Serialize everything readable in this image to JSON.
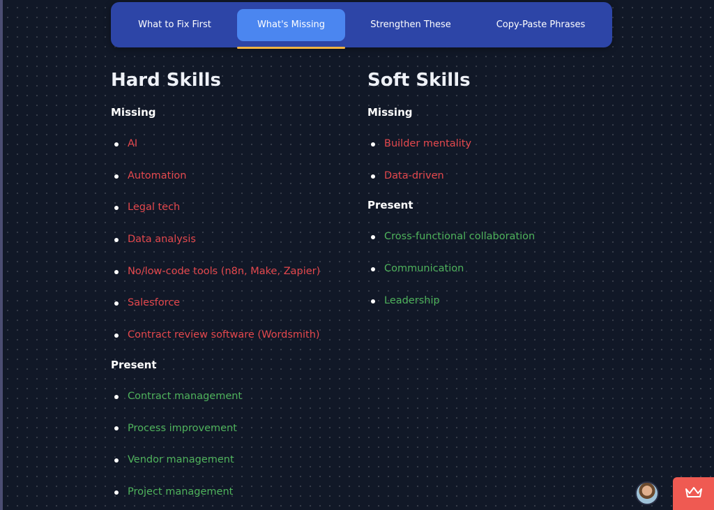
{
  "tabs": [
    {
      "label": "What to Fix First",
      "active": false
    },
    {
      "label": "What's Missing",
      "active": true
    },
    {
      "label": "Strengthen These",
      "active": false
    },
    {
      "label": "Copy-Paste Phrases",
      "active": false
    }
  ],
  "hard_skills": {
    "title": "Hard Skills",
    "missing_label": "Missing",
    "missing": [
      "AI",
      "Automation",
      "Legal tech",
      "Data analysis",
      "No/low-code tools (n8n, Make, Zapier)",
      "Salesforce",
      "Contract review software (Wordsmith)"
    ],
    "present_label": "Present",
    "present": [
      "Contract management",
      "Process improvement",
      "Vendor management",
      "Project management"
    ]
  },
  "soft_skills": {
    "title": "Soft Skills",
    "missing_label": "Missing",
    "missing": [
      "Builder mentality",
      "Data-driven"
    ],
    "present_label": "Present",
    "present": [
      "Cross-functional collaboration",
      "Communication",
      "Leadership"
    ]
  },
  "icons": {
    "avatar": "user-avatar-icon",
    "crown": "crown-icon"
  },
  "colors": {
    "missing": "#e5484d",
    "present": "#4fb35c",
    "active_tab": "#4b86f0",
    "tab_bar": "#2d45a7",
    "underline": "#f2b441",
    "crown_button": "#ef5a52"
  }
}
